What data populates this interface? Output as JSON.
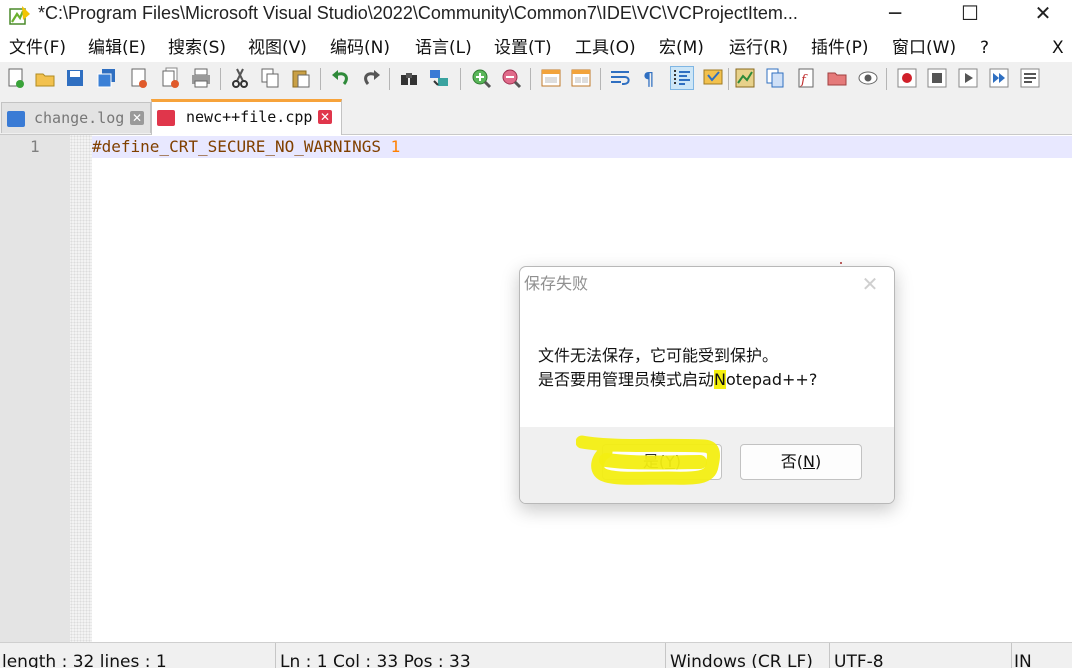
{
  "window": {
    "title": "*C:\\Program Files\\Microsoft Visual Studio\\2022\\Community\\Common7\\IDE\\VC\\VCProjectItem...",
    "minimize_glyph": "─",
    "maximize_glyph": "☐",
    "close_glyph": "✕"
  },
  "menu": {
    "items": [
      "文件(F)",
      "编辑(E)",
      "搜索(S)",
      "视图(V)",
      "编码(N)",
      "语言(L)",
      "设置(T)",
      "工具(O)",
      "宏(M)",
      "运行(R)",
      "插件(P)",
      "窗口(W)",
      "?"
    ],
    "close_doc": "X"
  },
  "toolbar": {
    "icons": [
      "new-file-icon",
      "open-file-icon",
      "save-icon",
      "save-all-icon",
      "close-icon",
      "close-all-icon",
      "print-icon",
      "cut-icon",
      "copy-icon",
      "paste-icon",
      "undo-icon",
      "redo-icon",
      "find-icon",
      "replace-icon",
      "zoom-in-icon",
      "zoom-out-icon",
      "sync-vertical-icon",
      "sync-horizontal-icon",
      "word-wrap-icon",
      "show-all-chars-icon",
      "indent-guide-icon",
      "user-lang-icon",
      "doc-map-icon",
      "doc-list-icon",
      "function-list-icon",
      "folder-workspace-icon",
      "monitoring-icon",
      "record-macro-icon",
      "stop-record-icon",
      "play-macro-icon",
      "run-macro-multiple-icon",
      "save-macro-icon"
    ]
  },
  "tabs": [
    {
      "label": "change.log",
      "icon": "saved-file-icon",
      "color": "#3a7bd5"
    },
    {
      "label": "newc++file.cpp",
      "icon": "unsaved-file-icon",
      "color": "#e0364b"
    }
  ],
  "editor": {
    "line_number": "1",
    "code_text": "#define_CRT_SECURE_NO_WARNINGS ",
    "code_number": "1"
  },
  "dialog": {
    "title": "保存失败",
    "close_glyph": "✕",
    "message_line1": "文件无法保存，它可能受到保护。",
    "message_line2_a": "是否要用管理员模式启动",
    "message_line2_highlight": "N",
    "message_line2_b": "otepad++?",
    "yes_text": "是(",
    "yes_key": "Y",
    "no_text": "否(",
    "no_key": "N",
    "close_paren": ")",
    "highlight_color": "#f5f00f"
  },
  "status": {
    "length": "length : 32    lines : 1",
    "position": "Ln : 1    Col : 33    Pos : 33",
    "eol": "Windows (CR LF)",
    "encoding": "UTF-8",
    "mode": "IN"
  }
}
